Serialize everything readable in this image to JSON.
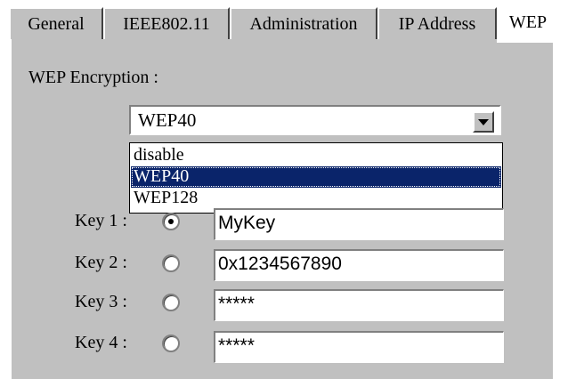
{
  "tabs": [
    {
      "label": "General",
      "active": false
    },
    {
      "label": "IEEE802.11",
      "active": false
    },
    {
      "label": "Administration",
      "active": false
    },
    {
      "label": "IP Address",
      "active": false
    },
    {
      "label": "WEP",
      "active": true
    }
  ],
  "wep": {
    "encryption_label": "WEP Encryption :",
    "selected": "WEP40",
    "options": [
      "disable",
      "WEP40",
      "WEP128"
    ],
    "selected_option_index": 1
  },
  "keys": [
    {
      "label": "Key 1 :",
      "value": "MyKey",
      "selected": true
    },
    {
      "label": "Key 2 :",
      "value": "0x1234567890",
      "selected": false
    },
    {
      "label": "Key 3 :",
      "value": "*****",
      "selected": false
    },
    {
      "label": "Key 4 :",
      "value": "*****",
      "selected": false
    }
  ]
}
